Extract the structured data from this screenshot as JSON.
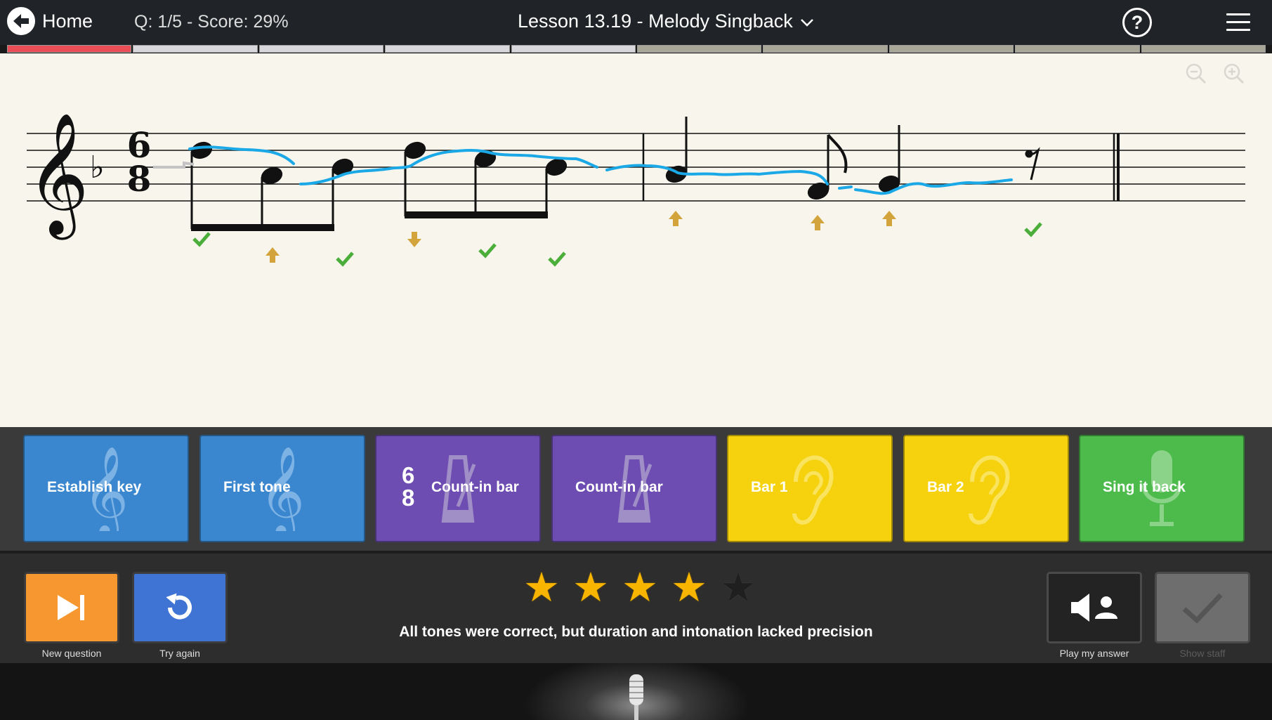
{
  "header": {
    "home_label": "Home",
    "score_text": "Q: 1/5 - Score: 29%",
    "lesson_title": "Lesson 13.19 - Melody Singback",
    "help_symbol": "?"
  },
  "progress": {
    "segments": [
      {
        "state": "current",
        "color": "#ea4d56"
      },
      {
        "state": "pending",
        "color": "#d8d8dc"
      },
      {
        "state": "pending",
        "color": "#d8d8dc"
      },
      {
        "state": "pending",
        "color": "#d8d8dc"
      },
      {
        "state": "pending",
        "color": "#d8d8dc"
      },
      {
        "state": "inactive",
        "color": "#a8a797"
      },
      {
        "state": "inactive",
        "color": "#a8a797"
      },
      {
        "state": "inactive",
        "color": "#a8a797"
      },
      {
        "state": "inactive",
        "color": "#a8a797"
      },
      {
        "state": "inactive",
        "color": "#a8a797"
      }
    ]
  },
  "staff": {
    "key_signature": "F major (1 flat)",
    "time_signature": {
      "top": "6",
      "bottom": "8"
    },
    "note_feedback": [
      "correct",
      "too-low",
      "correct",
      "too-high",
      "correct",
      "correct",
      "too-low",
      "too-low",
      "too-low",
      "correct"
    ]
  },
  "exercises": [
    {
      "label": "Establish key",
      "icon": "treble-clef-icon",
      "color": "#3a87cf"
    },
    {
      "label": "First tone",
      "icon": "treble-clef-icon",
      "color": "#3a87cf"
    },
    {
      "label": "Count-in bar",
      "icon": "metronome-icon",
      "color": "#6e4db3",
      "time_sig_top": "6",
      "time_sig_bottom": "8"
    },
    {
      "label": "Count-in bar",
      "icon": "metronome-icon",
      "color": "#6e4db3"
    },
    {
      "label": "Bar 1",
      "icon": "ear-icon",
      "color": "#f5d20d"
    },
    {
      "label": "Bar 2",
      "icon": "ear-icon",
      "color": "#f5d20d"
    },
    {
      "label": "Sing it back",
      "icon": "microphone-icon",
      "color": "#4cbb4b"
    }
  ],
  "controls": {
    "new_question": "New question",
    "try_again": "Try again",
    "play_my_answer": "Play my answer",
    "show_staff": "Show staff",
    "stars_filled": 4,
    "stars_total": 5,
    "feedback": "All tones were correct, but duration and intonation lacked precision"
  },
  "colors": {
    "star_filled": "#f7b500",
    "star_empty": "#1f1f1f",
    "pitch_trace": "#1ba8e6",
    "check": "#4cae3a",
    "arrow": "#d3a43b"
  }
}
